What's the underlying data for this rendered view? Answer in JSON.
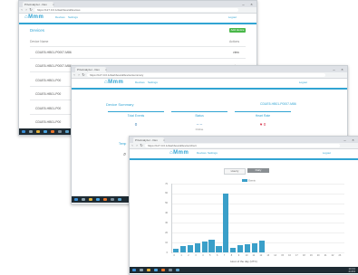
{
  "window1": {
    "tab_label": "PrivAnalyzer - Dev",
    "url": "https://127.0.0.1/dashboard/devices",
    "logo": "⌂Mmm",
    "menu": [
      "Devices",
      "Settings"
    ],
    "menu_right": "Logout",
    "section_title": "Devices",
    "add_button": "Add device",
    "column_left": "Device Name",
    "column_right": "Actions",
    "rows": [
      {
        "name": "CDUE5-HB01-P0007-M86",
        "value": "view"
      },
      {
        "name": "CDUE5-HB01-P0007-M86",
        "value": "view"
      },
      {
        "name": "CDUE5-HB01-P00",
        "value": "view"
      },
      {
        "name": "CDUE5-HB01-P00",
        "value": "view"
      },
      {
        "name": "CDUE5-HB01-P00",
        "value": "view"
      },
      {
        "name": "CDUE5-HB01-P00",
        "value": "view"
      }
    ]
  },
  "window2": {
    "tab_label": "PrivAnalyzer - Dev",
    "url": "https://127.0.0.1/dashboard/device/summary",
    "logo": "⌂Mmm",
    "menu": [
      "Devices",
      "Settings"
    ],
    "menu_right": "Logout",
    "section_title": "Device Summary",
    "device_id": "CDUE5-HB01-P0007-M86",
    "cards": [
      {
        "title": "Total Events",
        "value": "0",
        "sub": ""
      },
      {
        "title": "Status",
        "value": "‒ ‒",
        "sub": "Online"
      },
      {
        "title": "Heart Rate",
        "value": "♥ 0",
        "sub": ""
      }
    ],
    "bottom_label": "Temp"
  },
  "window3": {
    "tab_label": "PrivAnalyzer - Dev",
    "url": "https://127.0.0.1/dashboard/device/chart",
    "logo": "⌂Mmm",
    "menu": [
      "Devices",
      "Settings"
    ],
    "menu_right": "Logout",
    "toggle_left": "Hourly",
    "toggle_right": "Daily",
    "legend": "Events",
    "xlabel": "Hour of the day (UTC)"
  },
  "chart_data": {
    "type": "bar",
    "categories": [
      "0",
      "1",
      "2",
      "3",
      "4",
      "5",
      "6",
      "7",
      "8",
      "9",
      "10",
      "11",
      "12",
      "13",
      "14",
      "15",
      "16",
      "17",
      "18",
      "19",
      "20",
      "21",
      "22",
      "23"
    ],
    "values": [
      4,
      6,
      7,
      9,
      11,
      13,
      6,
      60,
      5,
      7,
      8,
      9,
      12,
      0,
      0,
      0,
      0,
      0,
      0,
      0,
      0,
      0,
      0,
      0
    ],
    "ylim": [
      0,
      70
    ],
    "yticks": [
      0,
      10,
      20,
      30,
      40,
      50,
      60,
      70
    ],
    "xlabel": "Hour of the day (UTC)",
    "ylabel": "",
    "series": [
      {
        "name": "Events",
        "values": [
          4,
          6,
          7,
          9,
          11,
          13,
          6,
          60,
          5,
          7,
          8,
          9,
          12,
          0,
          0,
          0,
          0,
          0,
          0,
          0,
          0,
          0,
          0,
          0
        ]
      }
    ],
    "grid": true,
    "legend": "top-center",
    "colors": {
      "bar": "#3a9fc9"
    }
  },
  "taskbar": {
    "clock1": "10:42\n21/03",
    "clock2": "10:43\n21/03",
    "clock3": "10:44\n21/03"
  },
  "colors": {
    "accent": "#31a4d3",
    "green": "#49b849",
    "taskbar": "#1e2b33"
  }
}
